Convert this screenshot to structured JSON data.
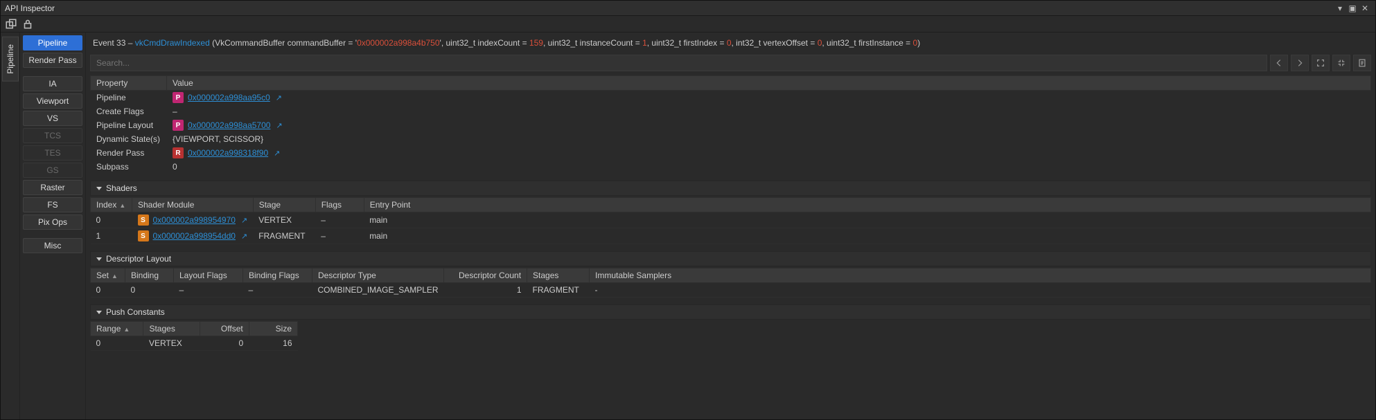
{
  "window": {
    "title": "API Inspector"
  },
  "vertical_tab": {
    "label": "Pipeline"
  },
  "sidebar": {
    "items": [
      {
        "label": "Pipeline",
        "state": "active"
      },
      {
        "label": "Render Pass",
        "state": "normal"
      },
      {
        "label": "IA",
        "state": "normal"
      },
      {
        "label": "Viewport",
        "state": "normal"
      },
      {
        "label": "VS",
        "state": "normal"
      },
      {
        "label": "TCS",
        "state": "disabled"
      },
      {
        "label": "TES",
        "state": "disabled"
      },
      {
        "label": "GS",
        "state": "disabled"
      },
      {
        "label": "Raster",
        "state": "normal"
      },
      {
        "label": "FS",
        "state": "normal"
      },
      {
        "label": "Pix Ops",
        "state": "normal"
      },
      {
        "label": "Misc",
        "state": "normal"
      }
    ]
  },
  "event": {
    "prefix": "Event 33 – ",
    "fn": "vkCmdDrawIndexed",
    "open": "(VkCommandBuffer commandBuffer = '",
    "arg_cb": "0x000002a998a4b750",
    "seg1": "', uint32_t indexCount = ",
    "arg_ic": "159",
    "seg2": ", uint32_t instanceCount = ",
    "arg_inst": "1",
    "seg3": ", uint32_t firstIndex = ",
    "arg_fi": "0",
    "seg4": ", int32_t vertexOffset = ",
    "arg_vo": "0",
    "seg5": ", uint32_t firstInstance = ",
    "arg_fin": "0",
    "close": ")"
  },
  "search": {
    "placeholder": "Search..."
  },
  "props": {
    "headers": {
      "property": "Property",
      "value": "Value"
    },
    "rows": {
      "pipeline": {
        "k": "Pipeline",
        "badge": "P",
        "link": "0x000002a998aa95c0"
      },
      "create_flags": {
        "k": "Create Flags",
        "v": "–"
      },
      "pipeline_layout": {
        "k": "Pipeline Layout",
        "badge": "P",
        "link": "0x000002a998aa5700"
      },
      "dynamic_states": {
        "k": "Dynamic State(s)",
        "v": "{VIEWPORT, SCISSOR}"
      },
      "render_pass": {
        "k": "Render Pass",
        "badge": "R",
        "link": "0x000002a998318f90"
      },
      "subpass": {
        "k": "Subpass",
        "v": "0"
      }
    }
  },
  "sections": {
    "shaders": {
      "title": "Shaders",
      "headers": {
        "index": "Index",
        "module": "Shader Module",
        "stage": "Stage",
        "flags": "Flags",
        "entry": "Entry Point"
      },
      "rows": [
        {
          "index": "0",
          "link": "0x000002a998954970",
          "stage": "VERTEX",
          "flags": "–",
          "entry": "main"
        },
        {
          "index": "1",
          "link": "0x000002a998954dd0",
          "stage": "FRAGMENT",
          "flags": "–",
          "entry": "main"
        }
      ]
    },
    "descriptor": {
      "title": "Descriptor Layout",
      "headers": {
        "set": "Set",
        "binding": "Binding",
        "layout_flags": "Layout Flags",
        "binding_flags": "Binding Flags",
        "dtype": "Descriptor Type",
        "count": "Descriptor Count",
        "stages": "Stages",
        "samplers": "Immutable Samplers"
      },
      "rows": [
        {
          "set": "0",
          "binding": "0",
          "layout_flags": "–",
          "binding_flags": "–",
          "dtype": "COMBINED_IMAGE_SAMPLER",
          "count": "1",
          "stages": "FRAGMENT",
          "samplers": "-"
        }
      ]
    },
    "push": {
      "title": "Push Constants",
      "headers": {
        "range": "Range",
        "stages": "Stages",
        "offset": "Offset",
        "size": "Size"
      },
      "rows": [
        {
          "range": "0",
          "stages": "VERTEX",
          "offset": "0",
          "size": "16"
        }
      ]
    }
  }
}
